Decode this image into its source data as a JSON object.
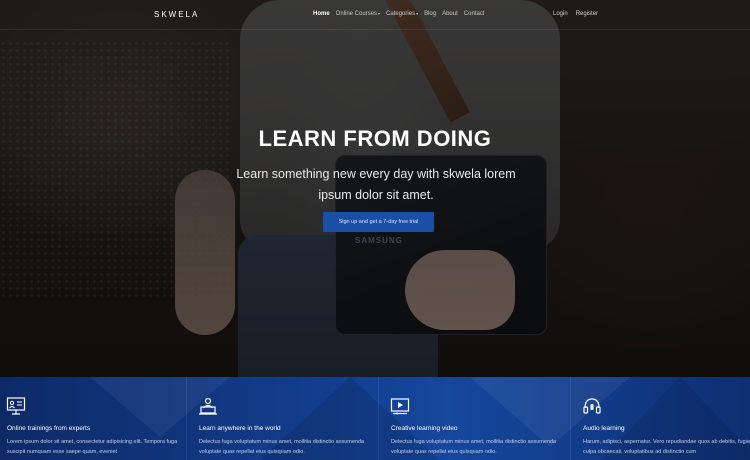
{
  "brand": "SKWELA",
  "nav": {
    "items": [
      {
        "label": "Home",
        "active": true
      },
      {
        "label": "Online Courses",
        "dropdown": true
      },
      {
        "label": "Categories",
        "dropdown": true
      },
      {
        "label": "Blog"
      },
      {
        "label": "About"
      },
      {
        "label": "Contact"
      }
    ],
    "login": "Login",
    "register": "Register",
    "caret": "▾"
  },
  "hero": {
    "title": "LEARN FROM DOING",
    "subtitle": "Learn something new every day with skwela lorem ipsum dolor sit amet.",
    "cta": "Sign up and get a 7-day free trial",
    "laptop_brand": "SAMSUNG"
  },
  "features": [
    {
      "icon": "presentation-icon",
      "title": "Online trainings from experts",
      "desc": "Lorem ipsum dolor sit amet, consectetur adipisicing elit. Tempora fuga suscipit numquam esse saepe quam, eveniet"
    },
    {
      "icon": "laptop-user-icon",
      "title": "Learn anywhere in the world",
      "desc": "Delectus fuga voluptatum minus amet, mollitia distinctio assumenda voluptate quas repellat eius quisquam odio."
    },
    {
      "icon": "video-icon",
      "title": "Creative learning video",
      "desc": "Delectus fuga voluptatum minus amet, mollitia distinctio assumenda voluptate quas repellat eius quisquam odio."
    },
    {
      "icon": "headphones-icon",
      "title": "Audio learning",
      "desc": "Harum, adipisci, aspernatur. Vero repudiandae quos ab debitis, fugiat culpa obcaecati, voluptatibus ad distinctio cum"
    }
  ],
  "colors": {
    "accent": "#1a4fa8",
    "features_bg": "#123a86"
  }
}
